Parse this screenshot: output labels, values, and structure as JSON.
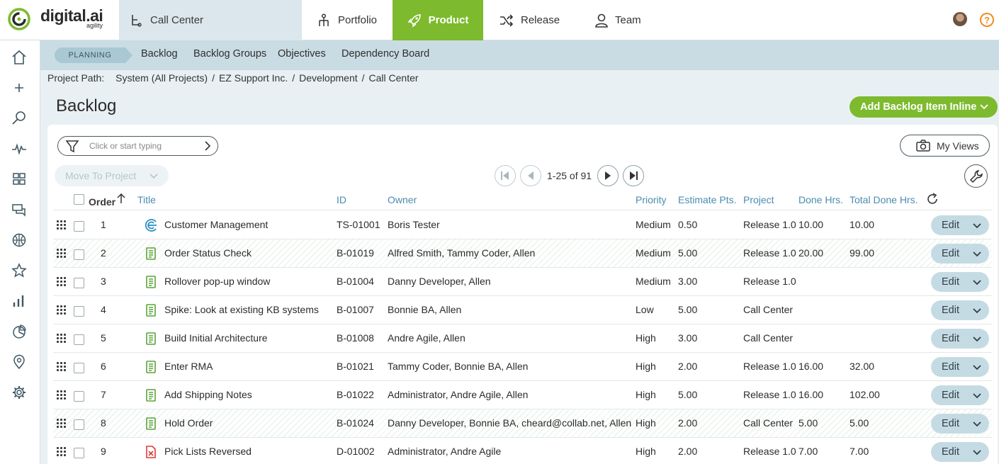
{
  "brand": {
    "name": "digital.ai",
    "sub": "agility"
  },
  "project_selector": {
    "label": "Call Center"
  },
  "nav": [
    {
      "label": "Portfolio",
      "icon": "portfolio-icon"
    },
    {
      "label": "Product",
      "icon": "rocket-icon",
      "active": true
    },
    {
      "label": "Release",
      "icon": "shuffle-icon"
    },
    {
      "label": "Team",
      "icon": "person-icon"
    }
  ],
  "help_label": "?",
  "rail_icons": [
    "home-icon",
    "plus-icon",
    "search-icon",
    "activity-icon",
    "grid-icon",
    "chat-icon",
    "basketball-icon",
    "star-icon",
    "bar-chart-icon",
    "pie-chart-icon",
    "location-icon",
    "gear-icon"
  ],
  "subnav": {
    "section": "PLANNING",
    "links": [
      "Backlog",
      "Backlog Groups",
      "Objectives",
      "Dependency Board"
    ]
  },
  "breadcrumb": {
    "label": "Project Path:",
    "items": [
      "System (All Projects)",
      "EZ Support Inc.",
      "Development",
      "Call Center"
    ],
    "sep": "/"
  },
  "page": {
    "title": "Backlog",
    "add_button": "Add Backlog Item Inline"
  },
  "toolbar": {
    "filter_placeholder": "Click or start typing",
    "my_views": "My Views",
    "move_to_project": "Move To Project",
    "pager_text": "1-25 of 91"
  },
  "columns": {
    "order": "Order",
    "title": "Title",
    "id": "ID",
    "owner": "Owner",
    "priority": "Priority",
    "estimate": "Estimate Pts.",
    "project": "Project",
    "done": "Done Hrs.",
    "total_done": "Total Done Hrs."
  },
  "edit_label": "Edit",
  "rows": [
    {
      "order": "1",
      "type": "epic",
      "title": "Customer Management",
      "id": "TS-01001",
      "owner": "Boris Tester",
      "priority": "Medium",
      "estimate": "0.50",
      "project": "Release 1.0",
      "done": "10.00",
      "total_done": "10.00",
      "hatched": false
    },
    {
      "order": "2",
      "type": "story",
      "title": "Order Status Check",
      "id": "B-01019",
      "owner": "Alfred Smith, Tammy Coder, Allen",
      "priority": "Medium",
      "estimate": "5.00",
      "project": "Release 1.0",
      "done": "20.00",
      "total_done": "99.00",
      "hatched": true
    },
    {
      "order": "3",
      "type": "story",
      "title": "Rollover pop-up window",
      "id": "B-01004",
      "owner": "Danny Developer, Allen",
      "priority": "Medium",
      "estimate": "3.00",
      "project": "Release 1.0",
      "done": "",
      "total_done": "",
      "hatched": false
    },
    {
      "order": "4",
      "type": "story",
      "title": "Spike: Look at existing KB systems",
      "id": "B-01007",
      "owner": "Bonnie BA, Allen",
      "priority": "Low",
      "estimate": "5.00",
      "project": "Call Center",
      "done": "",
      "total_done": "",
      "hatched": false
    },
    {
      "order": "5",
      "type": "story",
      "title": "Build Initial Architecture",
      "id": "B-01008",
      "owner": "Andre Agile, Allen",
      "priority": "High",
      "estimate": "3.00",
      "project": "Call Center",
      "done": "",
      "total_done": "",
      "hatched": false
    },
    {
      "order": "6",
      "type": "story",
      "title": "Enter RMA",
      "id": "B-01021",
      "owner": "Tammy Coder, Bonnie BA, Allen",
      "priority": "High",
      "estimate": "2.00",
      "project": "Release 1.0",
      "done": "16.00",
      "total_done": "32.00",
      "hatched": false
    },
    {
      "order": "7",
      "type": "story",
      "title": "Add Shipping Notes",
      "id": "B-01022",
      "owner": "Administrator, Andre Agile, Allen",
      "priority": "High",
      "estimate": "5.00",
      "project": "Release 1.0",
      "done": "16.00",
      "total_done": "102.00",
      "hatched": false
    },
    {
      "order": "8",
      "type": "story",
      "title": "Hold Order",
      "id": "B-01024",
      "owner": "Danny Developer, Bonnie BA, cheard@collab.net, Allen",
      "priority": "High",
      "estimate": "2.00",
      "project": "Call Center",
      "done": "5.00",
      "total_done": "5.00",
      "hatched": true
    },
    {
      "order": "9",
      "type": "defect",
      "title": "Pick Lists Reversed",
      "id": "D-01002",
      "owner": "Administrator, Andre Agile",
      "priority": "High",
      "estimate": "2.00",
      "project": "Release 1.0",
      "done": "7.00",
      "total_done": "7.00",
      "hatched": false
    }
  ],
  "colors": {
    "accent": "#7dba2e",
    "link": "#4a8cb0",
    "defect": "#e03a3a",
    "epic": "#2a8fc4",
    "help": "#f08c1d"
  }
}
